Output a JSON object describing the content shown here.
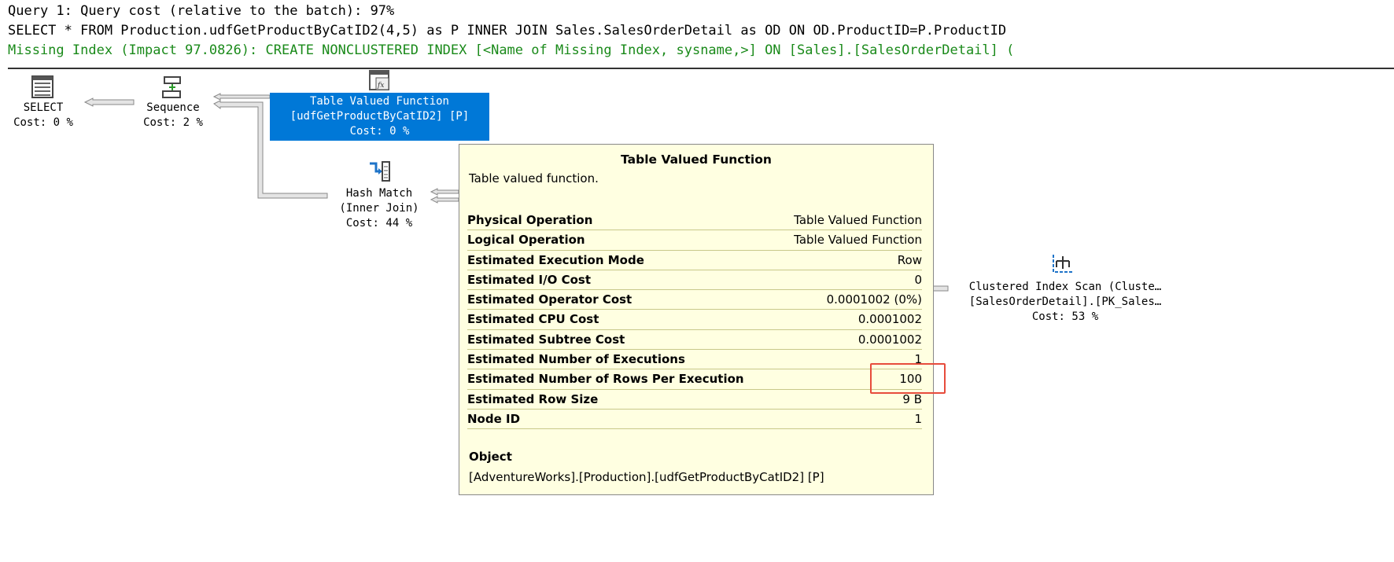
{
  "header": {
    "query_cost": "Query 1: Query cost (relative to the batch): 97%",
    "sql": "SELECT * FROM Production.udfGetProductByCatID2(4,5) as P INNER JOIN Sales.SalesOrderDetail as OD ON OD.ProductID=P.ProductID",
    "missing_index": "Missing Index (Impact 97.0826): CREATE NONCLUSTERED INDEX [<Name of Missing Index, sysname,>] ON [Sales].[SalesOrderDetail] ("
  },
  "nodes": {
    "select": {
      "name": "SELECT",
      "cost": "Cost: 0 %"
    },
    "sequence": {
      "name": "Sequence",
      "cost": "Cost: 2 %"
    },
    "tvf": {
      "name": "Table Valued Function",
      "object": "[udfGetProductByCatID2] [P]",
      "cost": "Cost: 0 %"
    },
    "hash": {
      "name": "Hash Match",
      "sub": "(Inner Join)",
      "cost": "Cost: 44 %"
    },
    "scan": {
      "name": "Clustered Index Scan (Cluste…",
      "object": "[SalesOrderDetail].[PK_Sales…",
      "cost": "Cost: 53 %"
    }
  },
  "tooltip": {
    "title": "Table Valued Function",
    "description": "Table valued function.",
    "rows": [
      {
        "k": "Physical Operation",
        "v": "Table Valued Function"
      },
      {
        "k": "Logical Operation",
        "v": "Table Valued Function"
      },
      {
        "k": "Estimated Execution Mode",
        "v": "Row"
      },
      {
        "k": "Estimated I/O Cost",
        "v": "0"
      },
      {
        "k": "Estimated Operator Cost",
        "v": "0.0001002 (0%)"
      },
      {
        "k": "Estimated CPU Cost",
        "v": "0.0001002"
      },
      {
        "k": "Estimated Subtree Cost",
        "v": "0.0001002"
      },
      {
        "k": "Estimated Number of Executions",
        "v": "1"
      },
      {
        "k": "Estimated Number of Rows Per Execution",
        "v": "100"
      },
      {
        "k": "Estimated Row Size",
        "v": "9 B"
      },
      {
        "k": "Node ID",
        "v": "1"
      }
    ],
    "object_label": "Object",
    "object_value": "[AdventureWorks].[Production].[udfGetProductByCatID2] [P]"
  },
  "colors": {
    "selected": "#0078d7",
    "tooltip_bg": "#ffffe1",
    "highlight": "#e74c3c",
    "missing_index": "#1a8a1a"
  }
}
